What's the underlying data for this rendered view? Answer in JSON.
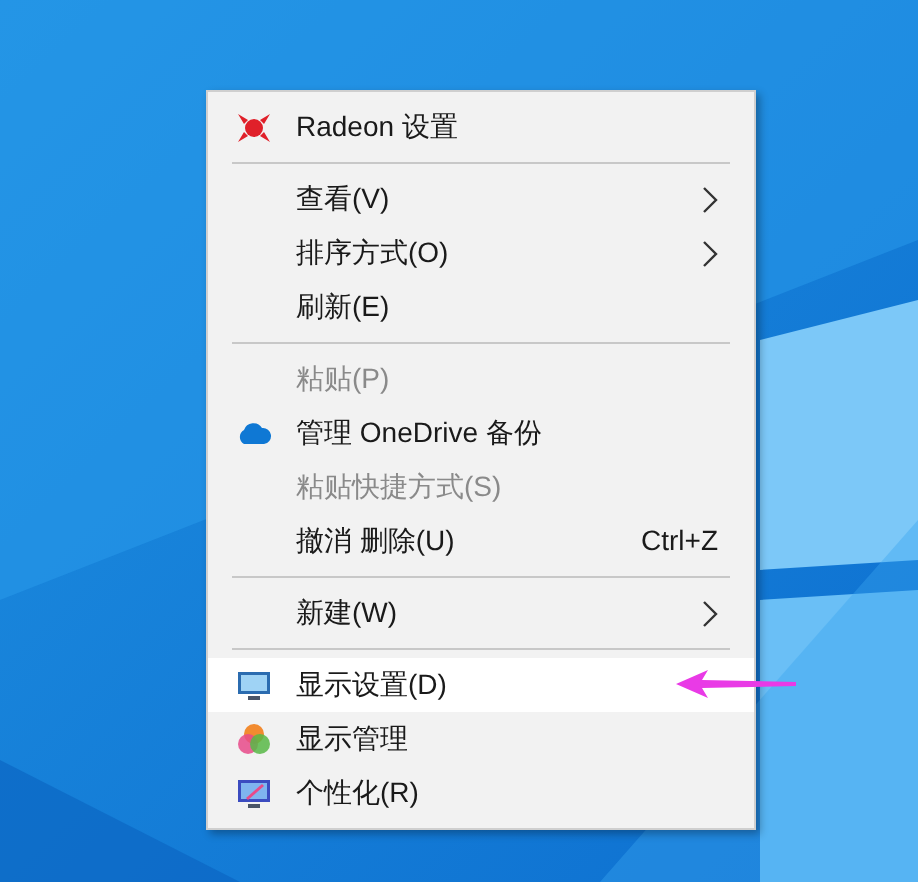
{
  "context_menu": {
    "items": [
      {
        "kind": "item",
        "label": "Radeon 设置",
        "disabled": false,
        "selected": false,
        "submenu": false
      },
      {
        "kind": "separator"
      },
      {
        "kind": "item",
        "label": "查看(V)",
        "disabled": false,
        "selected": false,
        "submenu": true
      },
      {
        "kind": "item",
        "label": "排序方式(O)",
        "disabled": false,
        "selected": false,
        "submenu": true
      },
      {
        "kind": "item",
        "label": "刷新(E)",
        "disabled": false,
        "selected": false,
        "submenu": false
      },
      {
        "kind": "separator"
      },
      {
        "kind": "item",
        "label": "粘贴(P)",
        "disabled": true,
        "selected": false,
        "submenu": false
      },
      {
        "kind": "item",
        "label": "管理 OneDrive 备份",
        "disabled": false,
        "selected": false,
        "submenu": false
      },
      {
        "kind": "item",
        "label": "粘贴快捷方式(S)",
        "disabled": true,
        "selected": false,
        "submenu": false
      },
      {
        "kind": "item",
        "label": "撤消 删除(U)",
        "shortcut": "Ctrl+Z",
        "disabled": false,
        "selected": false,
        "submenu": false
      },
      {
        "kind": "separator"
      },
      {
        "kind": "item",
        "label": "新建(W)",
        "disabled": false,
        "selected": false,
        "submenu": true
      },
      {
        "kind": "separator"
      },
      {
        "kind": "item",
        "label": "显示设置(D)",
        "disabled": false,
        "selected": true,
        "submenu": false
      },
      {
        "kind": "item",
        "label": "显示管理",
        "disabled": false,
        "selected": false,
        "submenu": false
      },
      {
        "kind": "item",
        "label": "个性化(R)",
        "disabled": false,
        "selected": false,
        "submenu": false
      }
    ]
  }
}
